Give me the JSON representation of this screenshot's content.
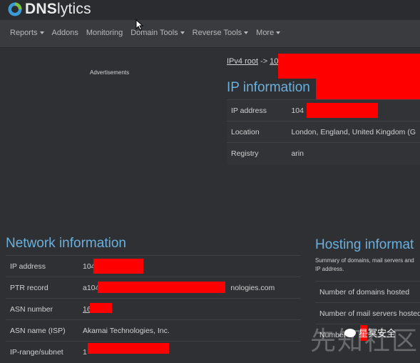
{
  "brand": {
    "name_bold": "DNS",
    "name_thin": "lytics"
  },
  "nav": {
    "items": [
      {
        "label": "Reports",
        "dropdown": true
      },
      {
        "label": "Addons",
        "dropdown": false
      },
      {
        "label": "Monitoring",
        "dropdown": false
      },
      {
        "label": "Domain Tools",
        "dropdown": true
      },
      {
        "label": "Reverse Tools",
        "dropdown": true
      },
      {
        "label": "More",
        "dropdown": true
      }
    ]
  },
  "ads_label": "Advertisements",
  "breadcrumb": {
    "root": "IPv4 root",
    "sep": "->",
    "current": "10"
  },
  "ip_info": {
    "title": "IP information",
    "rows": [
      {
        "key": "IP address",
        "value": "104"
      },
      {
        "key": "Location",
        "value": "London, England, United Kingdom (G"
      },
      {
        "key": "Registry",
        "value": "arin"
      }
    ]
  },
  "network_info": {
    "title": "Network information",
    "rows": [
      {
        "key": "IP address",
        "value": "104"
      },
      {
        "key": "PTR record",
        "value": "a104",
        "value_tail": "nologies.com"
      },
      {
        "key": "ASN number",
        "value": "16"
      },
      {
        "key": "ASN name (ISP)",
        "value": "Akamai Technologies, Inc."
      },
      {
        "key": "IP-range/subnet",
        "value": "1"
      }
    ]
  },
  "hosting_info": {
    "title": "Hosting informat",
    "description": "Summary of domains, mail servers and IP address.",
    "rows": [
      {
        "key": "Number of domains hosted"
      },
      {
        "key": "Number of mail servers hosted"
      },
      {
        "key": "Number of"
      }
    ]
  },
  "watermark": {
    "text": "先知社区",
    "badge": "星冥安全"
  },
  "colors": {
    "accent": "#6ab0de",
    "redaction": "#ff0000",
    "background": "#2f3033"
  }
}
